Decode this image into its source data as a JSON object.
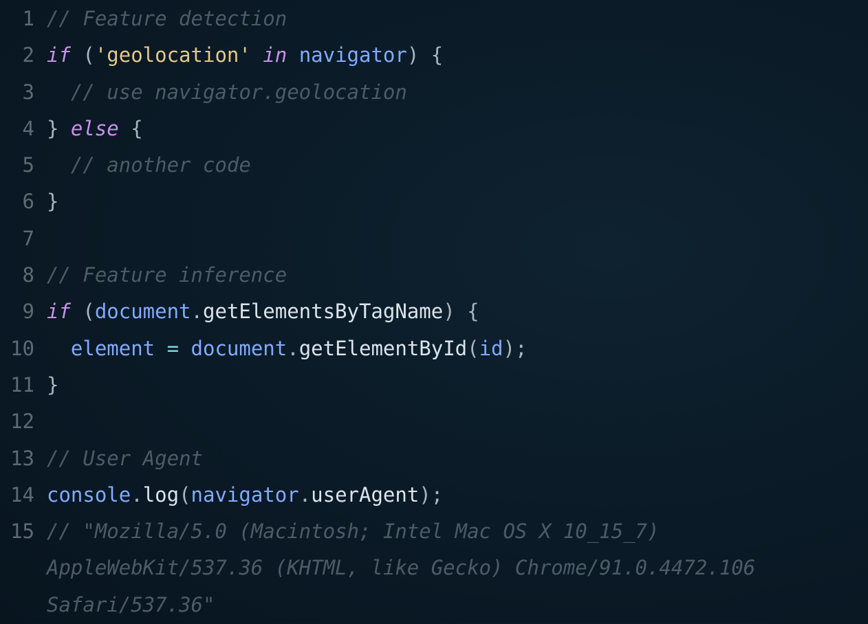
{
  "editor": {
    "lines": [
      {
        "number": "1",
        "tokens": [
          {
            "text": "// Feature detection",
            "type": "cmt"
          }
        ]
      },
      {
        "number": "2",
        "tokens": [
          {
            "text": "if",
            "type": "kw"
          },
          {
            "text": " (",
            "type": "punc"
          },
          {
            "text": "'geolocation'",
            "type": "str"
          },
          {
            "text": " ",
            "type": "punc"
          },
          {
            "text": "in",
            "type": "kw"
          },
          {
            "text": " ",
            "type": "punc"
          },
          {
            "text": "navigator",
            "type": "var"
          },
          {
            "text": ") {",
            "type": "punc"
          }
        ]
      },
      {
        "number": "3",
        "tokens": [
          {
            "text": "  // use navigator.geolocation",
            "type": "cmt"
          }
        ]
      },
      {
        "number": "4",
        "tokens": [
          {
            "text": "} ",
            "type": "punc"
          },
          {
            "text": "else",
            "type": "kw"
          },
          {
            "text": " {",
            "type": "punc"
          }
        ]
      },
      {
        "number": "5",
        "tokens": [
          {
            "text": "  // another code",
            "type": "cmt"
          }
        ]
      },
      {
        "number": "6",
        "tokens": [
          {
            "text": "}",
            "type": "punc"
          }
        ]
      },
      {
        "number": "7",
        "tokens": []
      },
      {
        "number": "8",
        "tokens": [
          {
            "text": "// Feature inference",
            "type": "cmt"
          }
        ]
      },
      {
        "number": "9",
        "tokens": [
          {
            "text": "if",
            "type": "kw"
          },
          {
            "text": " (",
            "type": "punc"
          },
          {
            "text": "document",
            "type": "var"
          },
          {
            "text": ".",
            "type": "punc"
          },
          {
            "text": "getElementsByTagName",
            "type": "fn"
          },
          {
            "text": ") {",
            "type": "punc"
          }
        ]
      },
      {
        "number": "10",
        "tokens": [
          {
            "text": "  ",
            "type": "punc"
          },
          {
            "text": "element",
            "type": "var"
          },
          {
            "text": " = ",
            "type": "op"
          },
          {
            "text": "document",
            "type": "var"
          },
          {
            "text": ".",
            "type": "punc"
          },
          {
            "text": "getElementById",
            "type": "fn"
          },
          {
            "text": "(",
            "type": "punc"
          },
          {
            "text": "id",
            "type": "var"
          },
          {
            "text": ");",
            "type": "punc"
          }
        ]
      },
      {
        "number": "11",
        "tokens": [
          {
            "text": "}",
            "type": "punc"
          }
        ]
      },
      {
        "number": "12",
        "tokens": []
      },
      {
        "number": "13",
        "tokens": [
          {
            "text": "// User Agent",
            "type": "cmt"
          }
        ]
      },
      {
        "number": "14",
        "tokens": [
          {
            "text": "console",
            "type": "var"
          },
          {
            "text": ".",
            "type": "punc"
          },
          {
            "text": "log",
            "type": "fn"
          },
          {
            "text": "(",
            "type": "punc"
          },
          {
            "text": "navigator",
            "type": "var"
          },
          {
            "text": ".",
            "type": "punc"
          },
          {
            "text": "userAgent",
            "type": "fn"
          },
          {
            "text": ");",
            "type": "punc"
          }
        ]
      },
      {
        "number": "15",
        "tokens": [
          {
            "text": "// \"Mozilla/5.0 (Macintosh; Intel Mac OS X 10_15_7)",
            "type": "cmt"
          }
        ]
      },
      {
        "number": "",
        "tokens": [
          {
            "text": "AppleWebKit/537.36 (KHTML, like Gecko) Chrome/91.0.4472.106",
            "type": "cmt"
          }
        ]
      },
      {
        "number": "",
        "tokens": [
          {
            "text": "Safari/537.36\"",
            "type": "cmt"
          }
        ]
      }
    ]
  }
}
